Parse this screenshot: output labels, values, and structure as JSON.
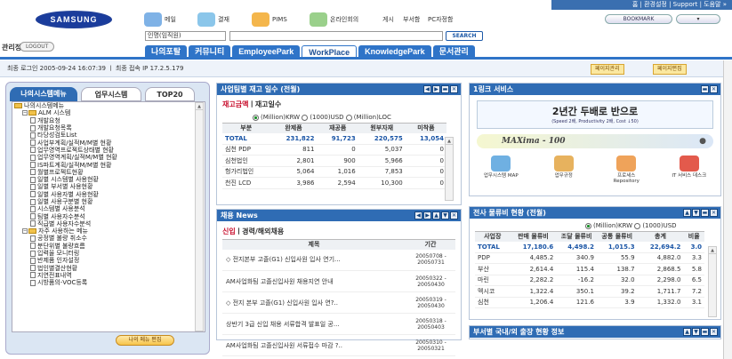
{
  "header": {
    "util_links": [
      "홈",
      "환경설정",
      "Support",
      "도움말"
    ],
    "logo_text": "SAMSUNG",
    "admin_label": "관리정",
    "logout": "LOGOUT",
    "top_menu": [
      {
        "label": "메일",
        "icon": "mail-icon"
      },
      {
        "label": "결재",
        "icon": "approval-icon"
      },
      {
        "label": "PIMS",
        "icon": "pims-icon"
      },
      {
        "label": "온라인회의",
        "icon": "meeting-icon"
      },
      {
        "label": "게시",
        "icon": ""
      },
      {
        "label": "부서함",
        "icon": ""
      },
      {
        "label": "PC자정함",
        "icon": ""
      }
    ],
    "search": {
      "dept_value": "인명(임직원)",
      "placeholder": "",
      "button": "SEARCH"
    },
    "bookmark": "BOOKMARK",
    "main_tabs": [
      "나의포탈",
      "커뮤니티",
      "EmployeePark",
      "WorkPlace",
      "KnowledgePark",
      "문서관리"
    ],
    "active_tab": "WorkPlace"
  },
  "login_bar": {
    "text": "최종 로그인  2005-09-24  16:07:39  ㅣ  최종 접속 IP  17.2.5.179",
    "btn_page_mgmt": "페이지관리",
    "btn_page_edit": "페이지편집"
  },
  "left": {
    "tabs": [
      "나의시스템메뉴",
      "업무시스템",
      "TOP20"
    ],
    "tree": [
      {
        "label": "나의시스템메뉴",
        "type": "folder",
        "depth": 0
      },
      {
        "label": "ALM 시스템",
        "type": "folder",
        "depth": 1
      },
      {
        "label": "개발요청",
        "type": "page",
        "depth": 2
      },
      {
        "label": "개발요청목록",
        "type": "page",
        "depth": 2
      },
      {
        "label": "타당성검토List",
        "type": "page",
        "depth": 2
      },
      {
        "label": "사업부계획/실적M/M별 현황",
        "type": "page",
        "depth": 2
      },
      {
        "label": "업무영역프로젝트상태별 현황",
        "type": "page",
        "depth": 2
      },
      {
        "label": "업무영역계획/실적M/M별 현황",
        "type": "page",
        "depth": 2
      },
      {
        "label": "IS파트계획/실적M/M별 현황",
        "type": "page",
        "depth": 2
      },
      {
        "label": "월별프로젝트현황",
        "type": "page",
        "depth": 2
      },
      {
        "label": "일별 시스템별 사용현황",
        "type": "page",
        "depth": 2
      },
      {
        "label": "일별 부서별 사용현황",
        "type": "page",
        "depth": 2
      },
      {
        "label": "일별 사용자별 사용현황",
        "type": "page",
        "depth": 2
      },
      {
        "label": "일별 사용구분별 현황",
        "type": "page",
        "depth": 2
      },
      {
        "label": "시스템별 사용분석",
        "type": "page",
        "depth": 2
      },
      {
        "label": "팀별 사용자수분석",
        "type": "page",
        "depth": 2
      },
      {
        "label": "직급별 사용자수분석",
        "type": "page",
        "depth": 2
      },
      {
        "label": "자주 사용하는 메뉴",
        "type": "folder",
        "depth": 1
      },
      {
        "label": "공정별 불량 취소수",
        "type": "page",
        "depth": 2
      },
      {
        "label": "분단위별 불량흐름",
        "type": "page",
        "depth": 2
      },
      {
        "label": "입력율 모니터링",
        "type": "page",
        "depth": 2
      },
      {
        "label": "반제품 인자설정",
        "type": "page",
        "depth": 2
      },
      {
        "label": "법인별결산현황",
        "type": "page",
        "depth": 2
      },
      {
        "label": "지연전표내역",
        "type": "page",
        "depth": 2
      },
      {
        "label": "시방품의-VOC등록",
        "type": "page",
        "depth": 2
      }
    ],
    "my_menu_button": "나의 메뉴 편집"
  },
  "inventory": {
    "title": "사업팀별 재고 일수 (전월)",
    "subtitle_red": "재고금액",
    "subtitle_rest": "ㅣ재고일수",
    "units": [
      "(Million)KRW",
      "(1000)USD",
      "(Million)LOC"
    ],
    "columns": [
      "부분",
      "완제품",
      "재공품",
      "원부자재",
      "미착품"
    ],
    "rows": [
      [
        "TOTAL",
        "231,822",
        "91,723",
        "220,575",
        "13,054"
      ],
      [
        "심천 PDP",
        "811",
        "0",
        "5,037",
        "0"
      ],
      [
        "심천법인",
        "2,801",
        "900",
        "5,966",
        "0"
      ],
      [
        "헝가리법인",
        "5,064",
        "1,016",
        "7,853",
        "0"
      ],
      [
        "천진 LCD",
        "3,986",
        "2,594",
        "10,300",
        "0"
      ]
    ]
  },
  "news": {
    "title": "채용 News",
    "subtitle_red": "신입",
    "subtitle_rest": "ㅣ경력/해외채용",
    "columns": [
      "제목",
      "기간"
    ],
    "rows": [
      [
        "◇ 전지본부 고졸(G1) 신입사원 입사 연기...",
        "20050708 - 20050731"
      ],
      [
        "AM사업화팀 고졸신입사원 채용지연 안내",
        "20050322 - 20050430"
      ],
      [
        "◇ 전지 본부 고졸(G1) 신입사원 입사 연?..",
        "20050319 - 20050430"
      ],
      [
        "상반기 3급 신입 채용 서류합격 발표일 공...",
        "20050318 - 20050403"
      ],
      [
        "AM사업화팀 고졸신입사원 서류접수 마감 ?..",
        "20050310 - 20050321"
      ]
    ]
  },
  "link": {
    "title": "1링크 서비스",
    "banner_big": "2년간 두배로 반으로",
    "banner_small": "(Speed 2배, Productivity 2배, Cost ↓50)",
    "maxima": "MAXima - 100",
    "icons": [
      "업무시스템 MAP",
      "업무규정",
      "프로세스 Repository",
      "IT 서비스 데스크"
    ]
  },
  "logistics": {
    "title": "전사 물류비 현황 (전월)",
    "units": [
      "(Million)KRW",
      "(1000)USD"
    ],
    "columns": [
      "사업장",
      "판매 물류비",
      "조달 물류비",
      "공통 물류비",
      "총계",
      "비율"
    ],
    "rows": [
      [
        "TOTAL",
        "17,180.6",
        "4,498.2",
        "1,015.3",
        "22,694.2",
        "3.0"
      ],
      [
        "PDP",
        "4,485.2",
        "340.9",
        "55.9",
        "4,882.0",
        "3.3"
      ],
      [
        "부산",
        "2,614.4",
        "115.4",
        "138.7",
        "2,868.5",
        "5.8"
      ],
      [
        "마린",
        "2,282.2",
        "-16.2",
        "32.0",
        "2,298.0",
        "6.5"
      ],
      [
        "멕시코",
        "1,322.4",
        "350.1",
        "39.2",
        "1,711.7",
        "7.2"
      ],
      [
        "심천",
        "1,206.4",
        "121.6",
        "3.9",
        "1,332.0",
        "3.1"
      ]
    ]
  },
  "status": {
    "title": "부서별 국내/외 출장 현황 정보"
  }
}
